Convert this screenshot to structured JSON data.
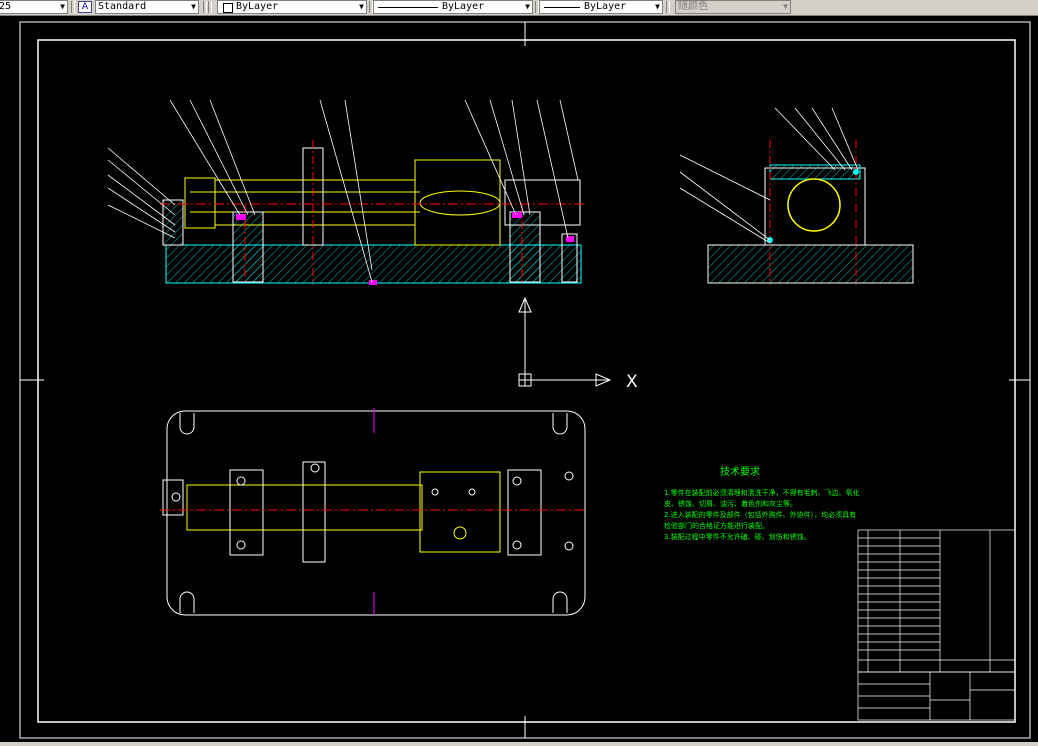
{
  "toolbar": {
    "scale_value": "25",
    "text_style": "Standard",
    "layer": "ByLayer",
    "linetype": "ByLayer",
    "lineweight": "ByLayer",
    "plot_style": "随颜色"
  },
  "ucs": {
    "x_label": "X"
  },
  "tech_requirements": {
    "title": "技术要求",
    "lines": [
      "1.零件在装配前必须清理和清洗干净，不得有毛刺、飞边、氧化",
      "皮、锈蚀、切屑、油污、着色剂和灰尘等。",
      "2.进入装配的零件及部件（包括外购件、外协件），均必须具有",
      "检验部门的合格证方能进行装配。",
      "3.装配过程中零件不允许磕、碰、划伤和锈蚀。"
    ]
  },
  "colors": {
    "background": "#000000",
    "outline": "#ffffff",
    "part": "#ffff00",
    "hatch": "#00ffff",
    "center": "#ff0000",
    "text_green": "#00ff00",
    "bolt": "#ff00ff"
  },
  "icons": [
    "dropdown-arrow-icon",
    "text-style-icon",
    "layer-color-swatch-icon",
    "ucs-icon"
  ]
}
